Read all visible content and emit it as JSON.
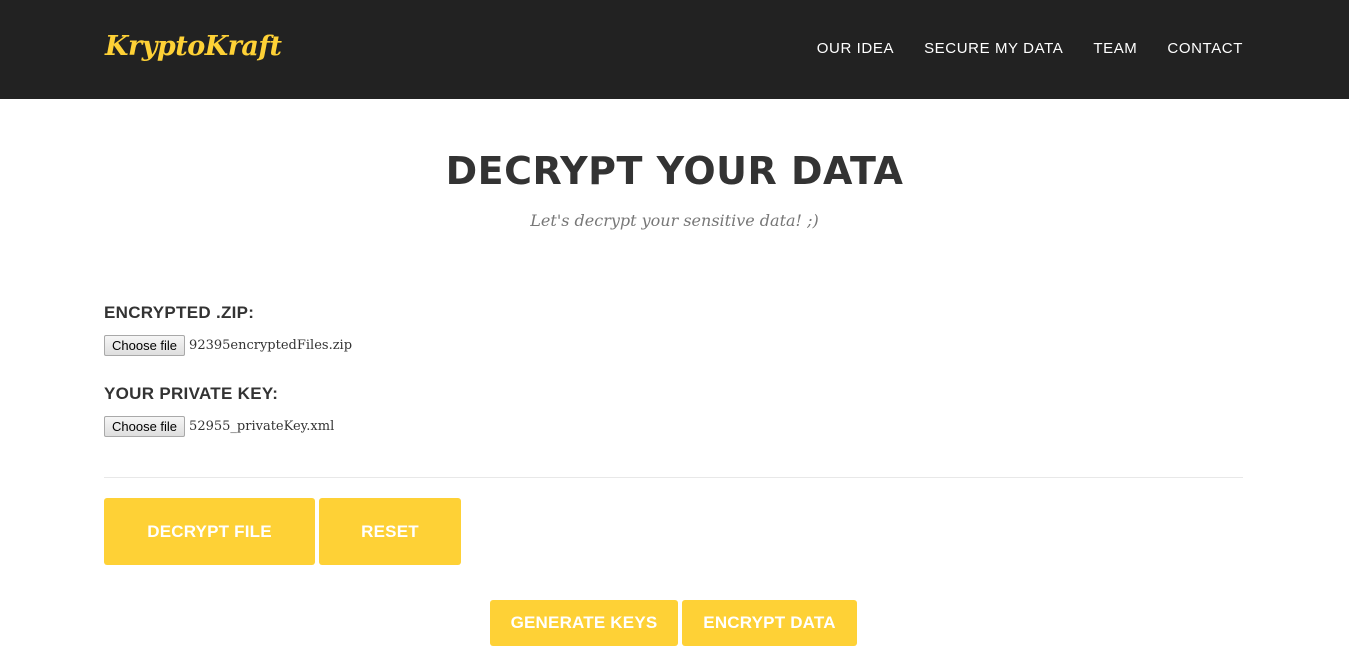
{
  "navbar": {
    "brand": "KryptoKraft",
    "links": [
      "OUR IDEA",
      "SECURE MY DATA",
      "TEAM",
      "CONTACT"
    ]
  },
  "section": {
    "title": "DECRYPT YOUR DATA",
    "subtitle": "Let's decrypt your sensitive data! ;)"
  },
  "form": {
    "zip_field": {
      "label": "ENCRYPTED .ZIP:",
      "button_label": "Choose file",
      "file_name": "92395encryptedFiles.zip"
    },
    "key_field": {
      "label": "YOUR PRIVATE KEY:",
      "button_label": "Choose file",
      "file_name": "52955_privateKey.xml"
    },
    "decrypt_label": "DECRYPT FILE",
    "reset_label": "RESET"
  },
  "footer_actions": {
    "generate_keys_label": "GENERATE KEYS",
    "encrypt_data_label": "ENCRYPT DATA"
  },
  "colors": {
    "navbar_bg": "#222222",
    "accent": "#fed136",
    "heading": "#333333",
    "muted": "#777777"
  }
}
